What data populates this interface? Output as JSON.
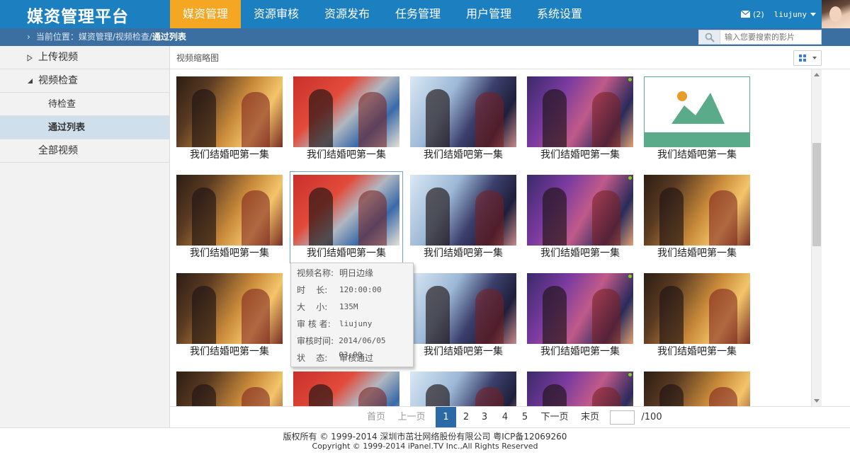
{
  "app": {
    "logo": "媒资管理平台"
  },
  "nav": [
    {
      "label": "媒资管理",
      "active": true
    },
    {
      "label": "资源审核",
      "active": false
    },
    {
      "label": "资源发布",
      "active": false
    },
    {
      "label": "任务管理",
      "active": false
    },
    {
      "label": "用户管理",
      "active": false
    },
    {
      "label": "系统设置",
      "active": false
    }
  ],
  "header": {
    "mail_count": "(2)",
    "username": "liujuny"
  },
  "breadcrumb": {
    "prefix": "当前位置：媒资管理/视频检查/",
    "current": "通过列表"
  },
  "search": {
    "placeholder": "输入您要搜索的影片"
  },
  "sidebar": {
    "items": [
      {
        "label": "上传视频"
      },
      {
        "label": "视频检查"
      },
      {
        "label": "待检查"
      },
      {
        "label": "通过列表"
      },
      {
        "label": "全部视频"
      }
    ]
  },
  "content": {
    "title": "视频缩略图"
  },
  "videos": {
    "caption": "我们结婚吧第一集"
  },
  "tooltip": {
    "rows": [
      {
        "key": "视频名称:",
        "value": "明日边缘"
      },
      {
        "key": "时    长:",
        "value": "120:00:00"
      },
      {
        "key": "大    小:",
        "value": "135M"
      },
      {
        "key": "审 核 者:",
        "value": "liujuny"
      },
      {
        "key": "审核时间:",
        "value": "2014/06/05 03:00"
      },
      {
        "key": "状    态:",
        "value": "审核通过"
      }
    ]
  },
  "pager": {
    "first": "首页",
    "prev": "上一页",
    "pages": [
      "1",
      "2",
      "3",
      "4",
      "5"
    ],
    "current": "1",
    "next": "下一页",
    "last": "末页",
    "total": "/100页"
  },
  "footer": {
    "line1": "版权所有 © 1999-2014 深圳市茁壮网络股份有限公司    粤ICP备12069260",
    "line2": "Copyright © 1999-2014 iPanel.TV Inc.,All Rights Reserved"
  },
  "colors": {
    "header": "#1c7fc0",
    "active_nav": "#f5a623",
    "crumb_bar": "#3b6fa1",
    "pager_active": "#2b6aa7"
  }
}
